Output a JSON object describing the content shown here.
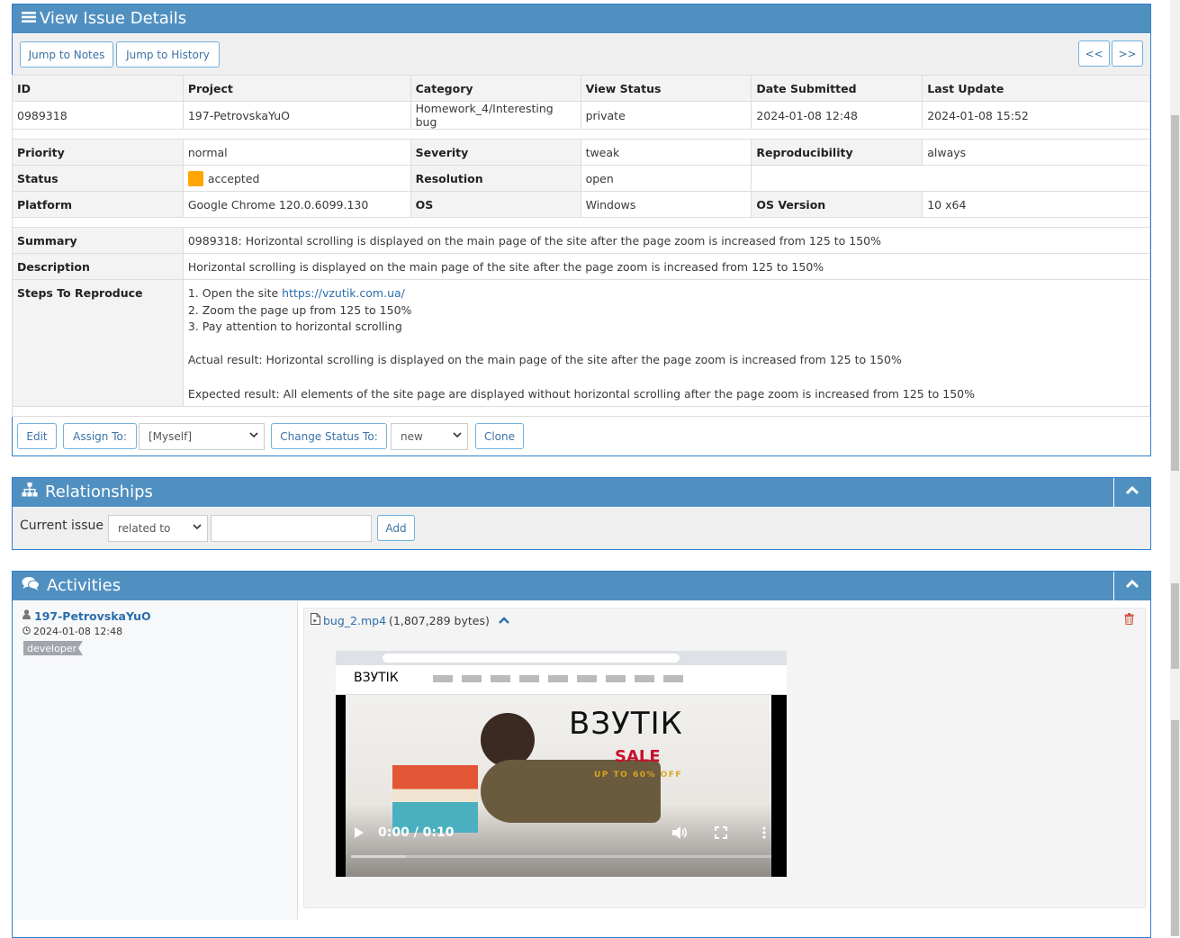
{
  "view_issue": {
    "title": "View Issue Details",
    "jump_notes": "Jump to Notes",
    "jump_history": "Jump to History",
    "prev": "<<",
    "next": ">>",
    "header_labels": [
      "ID",
      "Project",
      "Category",
      "View Status",
      "Date Submitted",
      "Last Update"
    ],
    "header_values": [
      "0989318",
      "197-PetrovskaYuO",
      "Homework_4/Interesting bug",
      "private",
      "2024-01-08 12:48",
      "2024-01-08 15:52"
    ],
    "priority_label": "Priority",
    "priority": "normal",
    "severity_label": "Severity",
    "severity": "tweak",
    "reproducibility_label": "Reproducibility",
    "reproducibility": "always",
    "status_label": "Status",
    "status": "accepted",
    "status_color": "#ffa500",
    "resolution_label": "Resolution",
    "resolution": "open",
    "platform_label": "Platform",
    "platform": "Google Chrome 120.0.6099.130",
    "os_label": "OS",
    "os": "Windows",
    "os_version_label": "OS Version",
    "os_version": "10 x64",
    "summary_label": "Summary",
    "summary": "0989318: Horizontal scrolling is displayed on the main page of the site after the page zoom is increased from 125 to 150%",
    "description_label": "Description",
    "description": "Horizontal scrolling is displayed on the main page of the site after the page zoom is increased from 125 to 150%",
    "steps_label": "Steps To Reproduce",
    "steps_line1_prefix": "1. Open the site ",
    "steps_link": "https://vzutik.com.ua/",
    "steps_line2": "2. Zoom the page up from 125 to 150%",
    "steps_line3": "3. Pay attention to horizontal scrolling",
    "actual": "Actual result: Horizontal scrolling is displayed on the main page of the site after the page zoom is increased from 125 to 150%",
    "expected": "Expected result: All elements of the site page are displayed without horizontal scrolling after the page zoom is increased from 125 to 150%",
    "edit": "Edit",
    "assign_to": "Assign To:",
    "assign_value": "[Myself]",
    "change_status": "Change Status To:",
    "status_value": "new",
    "clone": "Clone"
  },
  "relationships": {
    "title": "Relationships",
    "current_issue": "Current issue",
    "relation_value": "related to",
    "issue_input_value": "",
    "add": "Add"
  },
  "activities": {
    "title": "Activities",
    "user": "197-PetrovskaYuO",
    "date": "2024-01-08 12:48",
    "role": "developer",
    "file_name": "bug_2.mp4",
    "file_size": "(1,807,289 bytes)",
    "video_time": "0:00 / 0:10",
    "video_progress": 0.13,
    "video_brand": "ВЗУТІК",
    "video_sale": "SALE",
    "video_offer": "UP TO 60% OFF"
  },
  "colors": {
    "header_bg": "#5090c1",
    "border": "#307ecc",
    "link": "#2a6dab",
    "delete": "#d15b47"
  }
}
